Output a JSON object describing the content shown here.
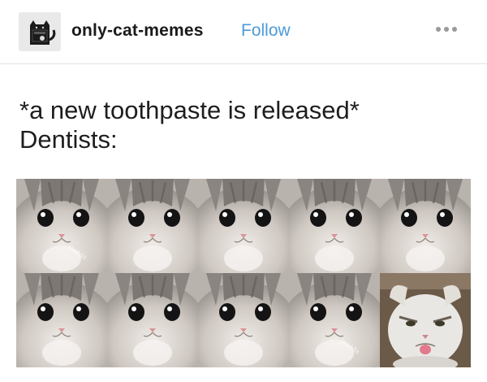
{
  "post": {
    "username": "only-cat-memes",
    "follow_label": "Follow",
    "avatar_icon": "cat-avatar-icon",
    "more_icon": "more-options-icon"
  },
  "caption": {
    "line1": "*a new toothpaste is released*",
    "line2": "Dentists:"
  },
  "meme": {
    "watermark": "Hedda",
    "cells": [
      {
        "kind": "happy-kitten-icon",
        "watermark": true
      },
      {
        "kind": "happy-kitten-icon",
        "watermark": false
      },
      {
        "kind": "happy-kitten-icon",
        "watermark": false
      },
      {
        "kind": "happy-kitten-icon",
        "watermark": false
      },
      {
        "kind": "happy-kitten-icon",
        "watermark": false
      },
      {
        "kind": "happy-kitten-icon",
        "watermark": false
      },
      {
        "kind": "happy-kitten-icon",
        "watermark": false
      },
      {
        "kind": "happy-kitten-icon",
        "watermark": false
      },
      {
        "kind": "happy-kitten-icon",
        "watermark": true
      },
      {
        "kind": "grumpy-cat-icon",
        "watermark": false
      }
    ]
  },
  "colors": {
    "follow": "#4c9bd8",
    "text": "#1e1e1e",
    "divider": "#e2e2e2"
  }
}
